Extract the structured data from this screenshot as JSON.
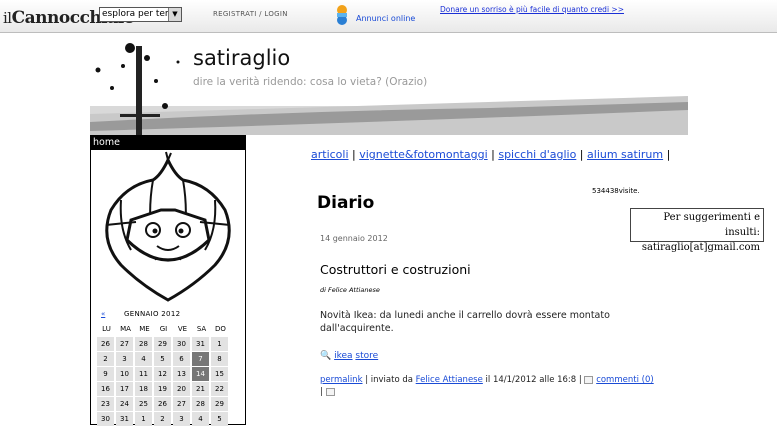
{
  "topbar": {
    "logo_pre": "il",
    "logo_main": "Cannocchiale",
    "explore_select": "esplora per temi",
    "register_login": "REGISTRATI / LOGIN",
    "annunci": "Annunci online",
    "donate": "Donare un sorriso è più facile di quanto credi >>"
  },
  "header": {
    "title": "satiraglio",
    "subtitle": "dire la verità ridendo: cosa lo vieta? (Orazio)"
  },
  "sidebar": {
    "home": "home",
    "calendar": {
      "prev": "«",
      "month": "GENNAIO 2012",
      "days": [
        "LU",
        "MA",
        "ME",
        "GI",
        "VE",
        "SA",
        "DO"
      ],
      "weeks": [
        [
          "26",
          "27",
          "28",
          "29",
          "30",
          "31",
          "1"
        ],
        [
          "2",
          "3",
          "4",
          "5",
          "6",
          "7",
          "8"
        ],
        [
          "9",
          "10",
          "11",
          "12",
          "13",
          "14",
          "15"
        ],
        [
          "16",
          "17",
          "18",
          "19",
          "20",
          "21",
          "22"
        ],
        [
          "23",
          "24",
          "25",
          "26",
          "27",
          "28",
          "29"
        ],
        [
          "30",
          "31",
          "1",
          "2",
          "3",
          "4",
          "5"
        ]
      ],
      "highlighted": [
        "7",
        "14"
      ]
    }
  },
  "nav": {
    "items": [
      "articoli",
      "vignette&fotomontaggi",
      "spicchi d'aglio",
      "alium satirum"
    ],
    "separator": "|"
  },
  "visits": "534438visite.",
  "note": {
    "line1": "Per suggerimenti e insulti:",
    "line2": "satiraglio[at]gmail.com"
  },
  "main": {
    "section": "Diario",
    "date": "14 gennaio 2012",
    "post_title": "Costruttori e costruzioni",
    "author": "di Felice Attianese",
    "body": "Novità Ikea: da lunedi anche il carrello dovrà essere montato dall'acquirente.",
    "tags": [
      "ikea",
      "store"
    ],
    "meta": {
      "permalink": "permalink",
      "sent_by": " | inviato da ",
      "author_link": "Felice Attianese",
      "when": " il 14/1/2012 alle 16:8 | ",
      "comments": "commenti (0)",
      "trail": "|"
    }
  }
}
